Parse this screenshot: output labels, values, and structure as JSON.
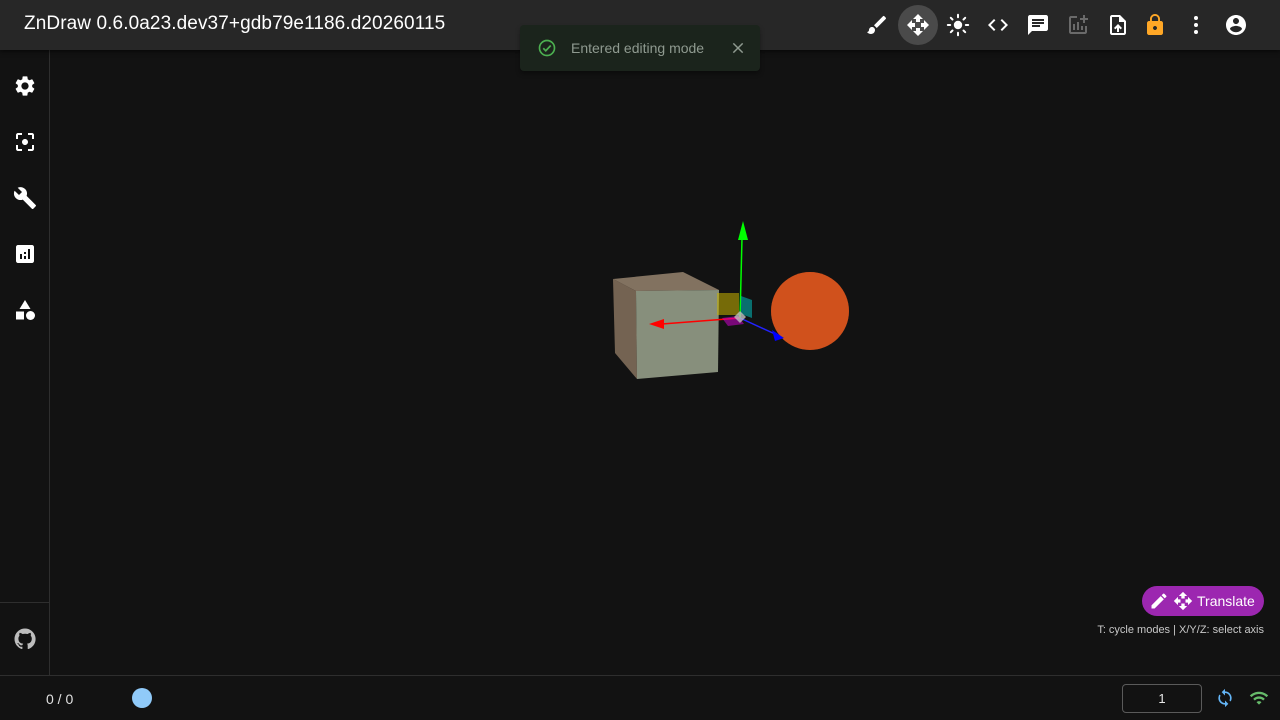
{
  "app": {
    "title": "ZnDraw 0.6.0a23.dev37+gdb79e1186.d20260115"
  },
  "toolbar": {
    "buttons": [
      {
        "icon": "brush-icon",
        "active": false
      },
      {
        "icon": "move-icon",
        "active": true
      },
      {
        "icon": "brightness-icon",
        "active": false
      },
      {
        "icon": "code-icon",
        "active": false
      },
      {
        "icon": "chat-icon",
        "active": false
      },
      {
        "icon": "add-chart-icon",
        "active": false,
        "disabled": true
      },
      {
        "icon": "upload-file-icon",
        "active": false
      },
      {
        "icon": "lock-icon",
        "active": false,
        "color": "#ffa726"
      },
      {
        "icon": "more-vert-icon",
        "active": false
      },
      {
        "icon": "account-circle-icon",
        "active": false
      }
    ]
  },
  "sidebar": {
    "items": [
      {
        "icon": "settings-icon"
      },
      {
        "icon": "center-focus-icon"
      },
      {
        "icon": "wrench-icon"
      },
      {
        "icon": "analytics-icon"
      },
      {
        "icon": "category-icon"
      }
    ],
    "footer_icon": "github-icon"
  },
  "toast": {
    "message": "Entered editing mode",
    "icon": "check-circle-icon",
    "color": "#66bb6a"
  },
  "transform": {
    "mode_label": "Translate",
    "hint": "T: cycle modes | X/Y/Z: select axis",
    "chip_color": "#9c27b0"
  },
  "bottom": {
    "frame_counter": "0 / 0",
    "frame_input": "1",
    "slider_color": "#90caf9"
  },
  "scene": {
    "cube_color": "#8a9a82",
    "sphere_color": "#d4531e",
    "axis_colors": {
      "x": "#ff0000",
      "y": "#00ff00",
      "z": "#0000ff"
    }
  }
}
